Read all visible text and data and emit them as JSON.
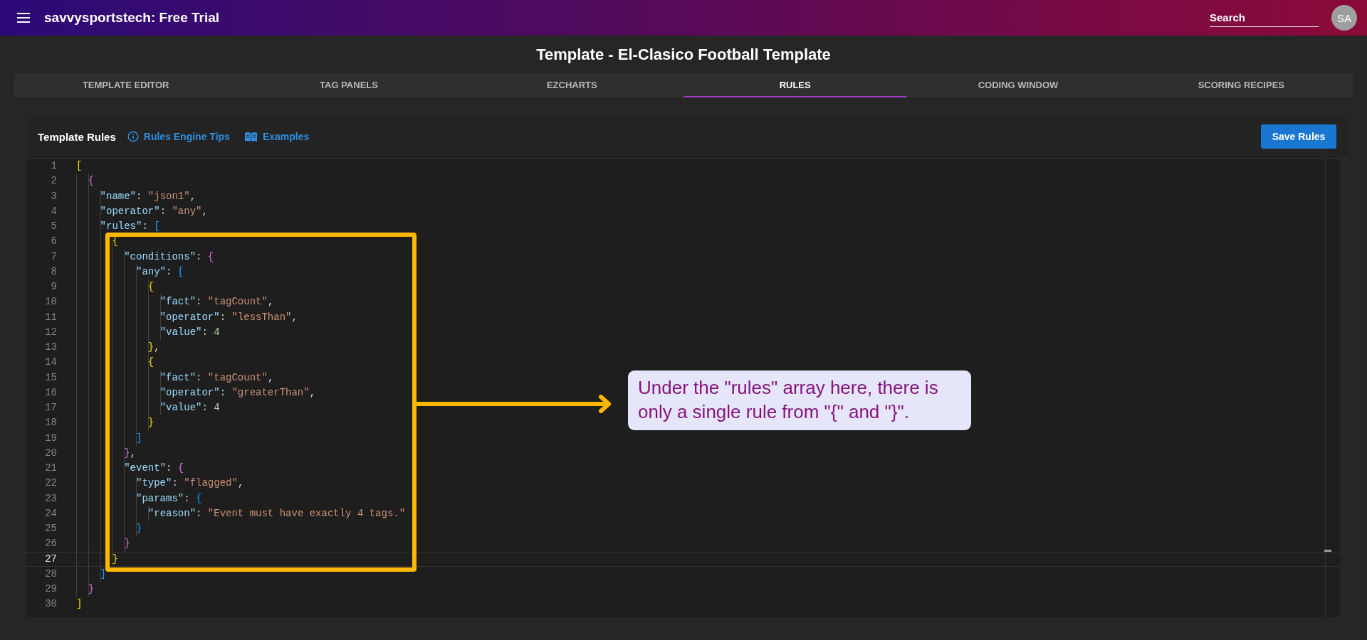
{
  "app_bar": {
    "title": "savvysportstech: Free Trial",
    "search": {
      "placeholder": "Search"
    },
    "avatar": "SA"
  },
  "page_title": "Template - El-Clasico Football Template",
  "tabs": [
    {
      "label": "TEMPLATE EDITOR",
      "selected": false
    },
    {
      "label": "TAG PANELS",
      "selected": false
    },
    {
      "label": "EZCHARTS",
      "selected": false
    },
    {
      "label": "RULES",
      "selected": true
    },
    {
      "label": "CODING WINDOW",
      "selected": false
    },
    {
      "label": "SCORING RECIPES",
      "selected": false
    }
  ],
  "panel": {
    "title": "Template Rules",
    "links": [
      {
        "label": "Rules Engine Tips",
        "kind": "info"
      },
      {
        "label": "Examples",
        "kind": "book"
      }
    ],
    "save_button": "Save Rules"
  },
  "editor": {
    "lines": [
      {
        "number": "1",
        "current": false,
        "text": "["
      },
      {
        "number": "2",
        "current": false,
        "text": "  {"
      },
      {
        "number": "3",
        "current": false,
        "text": "    \"name\": \"json1\","
      },
      {
        "number": "4",
        "current": false,
        "text": "    \"operator\": \"any\","
      },
      {
        "number": "5",
        "current": false,
        "text": "    \"rules\": ["
      },
      {
        "number": "6",
        "current": false,
        "text": "      {"
      },
      {
        "number": "7",
        "current": false,
        "text": "        \"conditions\": {"
      },
      {
        "number": "8",
        "current": false,
        "text": "          \"any\": ["
      },
      {
        "number": "9",
        "current": false,
        "text": "            {"
      },
      {
        "number": "10",
        "current": false,
        "text": "              \"fact\": \"tagCount\","
      },
      {
        "number": "11",
        "current": false,
        "text": "              \"operator\": \"lessThan\","
      },
      {
        "number": "12",
        "current": false,
        "text": "              \"value\": 4"
      },
      {
        "number": "13",
        "current": false,
        "text": "            },"
      },
      {
        "number": "14",
        "current": false,
        "text": "            {"
      },
      {
        "number": "15",
        "current": false,
        "text": "              \"fact\": \"tagCount\","
      },
      {
        "number": "16",
        "current": false,
        "text": "              \"operator\": \"greaterThan\","
      },
      {
        "number": "17",
        "current": false,
        "text": "              \"value\": 4"
      },
      {
        "number": "18",
        "current": false,
        "text": "            }"
      },
      {
        "number": "19",
        "current": false,
        "text": "          ]"
      },
      {
        "number": "20",
        "current": false,
        "text": "        },"
      },
      {
        "number": "21",
        "current": false,
        "text": "        \"event\": {"
      },
      {
        "number": "22",
        "current": false,
        "text": "          \"type\": \"flagged\","
      },
      {
        "number": "23",
        "current": false,
        "text": "          \"params\": {"
      },
      {
        "number": "24",
        "current": false,
        "text": "            \"reason\": \"Event must have exactly 4 tags.\""
      },
      {
        "number": "25",
        "current": false,
        "text": "          }"
      },
      {
        "number": "26",
        "current": false,
        "text": "        }"
      },
      {
        "number": "27",
        "current": true,
        "text": "      }"
      },
      {
        "number": "28",
        "current": false,
        "text": "    ]"
      },
      {
        "number": "29",
        "current": false,
        "text": "  }"
      },
      {
        "number": "30",
        "current": false,
        "text": "]"
      }
    ]
  },
  "annotation": {
    "callout": "Under the \"rules\" array here, there is only a single rule from \"{\" and \"}\"."
  }
}
